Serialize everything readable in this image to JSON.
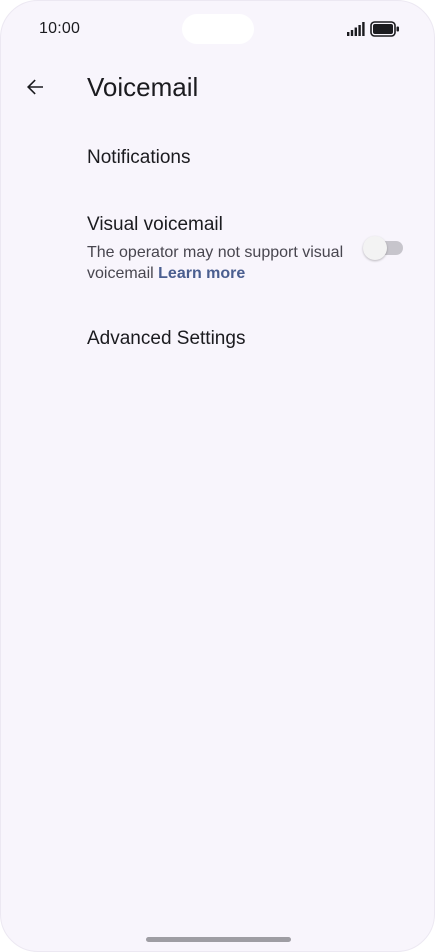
{
  "status_bar": {
    "time": "10:00",
    "signal_icon": "signal-bars-icon",
    "battery_icon": "battery-full-icon"
  },
  "header": {
    "back_icon": "arrow-left-icon",
    "title": "Voicemail"
  },
  "settings": {
    "notifications": {
      "title": "Notifications"
    },
    "visual_voicemail": {
      "title": "Visual voicemail",
      "summary": "The operator may not support visual voicemail",
      "link": "Learn more",
      "enabled": false
    },
    "advanced": {
      "title": "Advanced Settings"
    }
  },
  "colors": {
    "background": "#f8f5fc",
    "link": "#4a5e8f",
    "text": "#1b1b1f"
  }
}
